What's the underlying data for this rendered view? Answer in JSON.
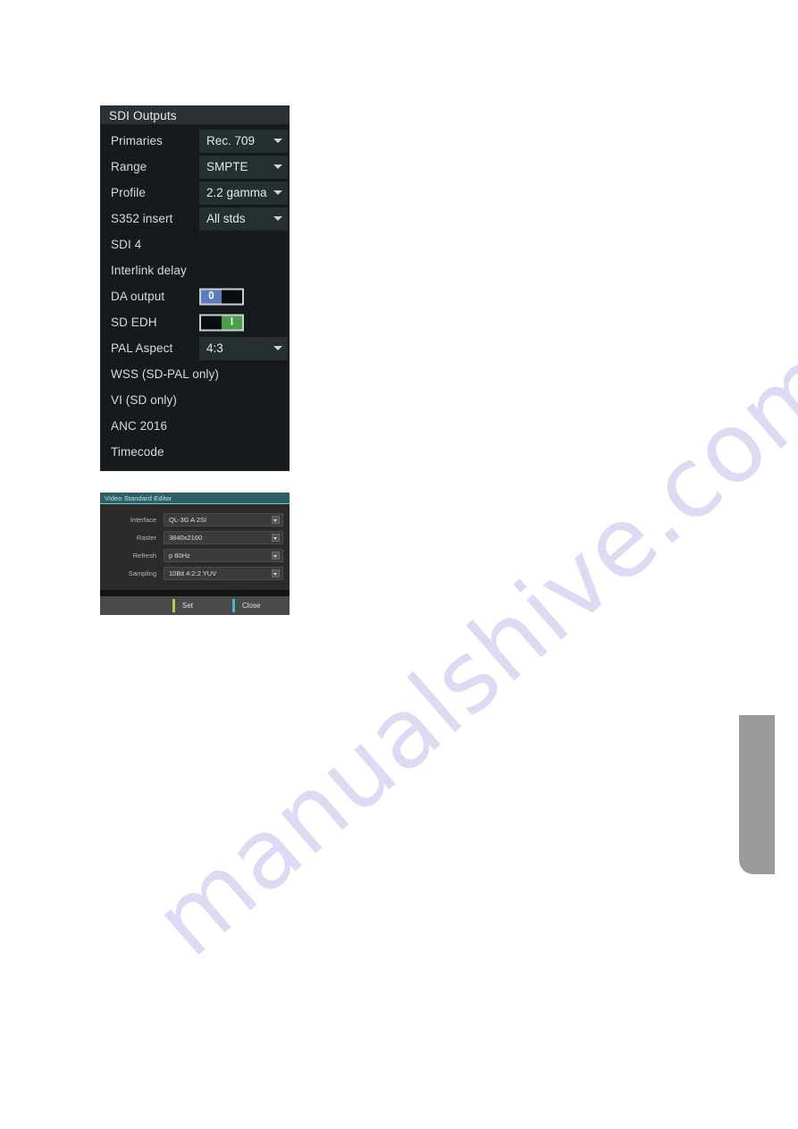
{
  "page": {
    "background": "#ffffff",
    "watermark_text": "manualshive.com",
    "watermark_color": "#c9c4ee"
  },
  "page_tab": {
    "name": "page-edge-tab",
    "color": "#9b9b9b"
  },
  "sdi_outputs": {
    "title": "SDI Outputs",
    "title_bar_color": "#2b3237",
    "panel_background": "#161a1c",
    "rows": [
      {
        "label": "Primaries",
        "control": "dropdown",
        "value": "Rec. 709"
      },
      {
        "label": "Range",
        "control": "dropdown",
        "value": "SMPTE"
      },
      {
        "label": "Profile",
        "control": "dropdown",
        "value": "2.2 gamma"
      },
      {
        "label": "S352 insert",
        "control": "dropdown",
        "value": "All stds"
      },
      {
        "label": "SDI 4",
        "control": "none",
        "value": ""
      },
      {
        "label": "Interlink delay",
        "control": "none",
        "value": ""
      },
      {
        "label": "DA output",
        "control": "toggle",
        "value": "0",
        "state": "off"
      },
      {
        "label": "SD EDH",
        "control": "toggle",
        "value": "I",
        "state": "on"
      },
      {
        "label": "PAL Aspect",
        "control": "dropdown",
        "value": "4:3"
      },
      {
        "label": "WSS (SD-PAL only)",
        "control": "none",
        "value": ""
      },
      {
        "label": "VI (SD only)",
        "control": "none",
        "value": ""
      },
      {
        "label": "ANC 2016",
        "control": "none",
        "value": ""
      },
      {
        "label": "Timecode",
        "control": "none",
        "value": ""
      }
    ],
    "toggle_off_color": "#5b7cb8",
    "toggle_on_color": "#4d9e4a"
  },
  "video_standard_editor": {
    "title": "Video Standard Editor",
    "title_bar_color": "#2d6066",
    "rows": [
      {
        "label": "Interface",
        "value": "QL-3G A 2SI"
      },
      {
        "label": "Raster",
        "value": "3840x2160"
      },
      {
        "label": "Refresh",
        "value": "p 60Hz"
      },
      {
        "label": "Sampling",
        "value": "10Bit 4:2:2 YUV"
      }
    ],
    "buttons": [
      {
        "label": "Set",
        "accent": "#c6c44a"
      },
      {
        "label": "Close",
        "accent": "#4ab5c6"
      }
    ]
  }
}
